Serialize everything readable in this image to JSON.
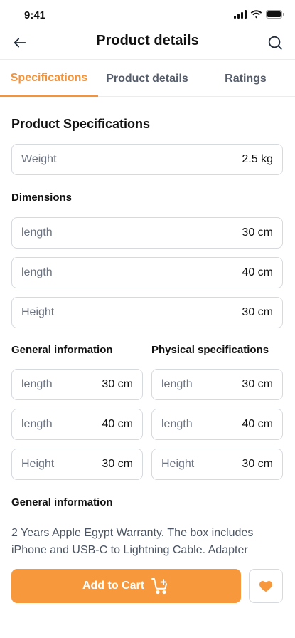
{
  "status_bar": {
    "time": "9:41"
  },
  "header": {
    "title": "Product details"
  },
  "tabs": [
    {
      "label": "Specifications",
      "active": true
    },
    {
      "label": "Product details",
      "active": false
    },
    {
      "label": "Ratings",
      "active": false
    }
  ],
  "specs": {
    "title": "Product Specifications",
    "weight": {
      "label": "Weight",
      "value": "2.5 kg"
    }
  },
  "dimensions": {
    "title": "Dimensions",
    "rows": [
      {
        "label": "length",
        "value": "30 cm"
      },
      {
        "label": "length",
        "value": "40 cm"
      },
      {
        "label": "Height",
        "value": "30 cm"
      }
    ]
  },
  "general_info": {
    "title": "General information",
    "rows": [
      {
        "label": "length",
        "value": "30 cm"
      },
      {
        "label": "length",
        "value": "40 cm"
      },
      {
        "label": "Height",
        "value": "30 cm"
      }
    ]
  },
  "physical_specs": {
    "title": "Physical specifications",
    "rows": [
      {
        "label": "length",
        "value": "30 cm"
      },
      {
        "label": "length",
        "value": "40 cm"
      },
      {
        "label": "Height",
        "value": "30 cm"
      }
    ]
  },
  "description": {
    "title": "General information",
    "text": "2 Years Apple Egypt Warranty. The box includes iPhone and USB-C to Lightning Cable. Adapter"
  },
  "actions": {
    "add_to_cart": "Add to Cart"
  },
  "colors": {
    "accent": "#f7983d",
    "text": "#111827",
    "muted": "#6b7280",
    "border": "#d6d9de"
  }
}
